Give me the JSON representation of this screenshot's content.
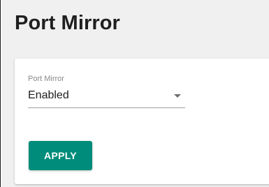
{
  "page": {
    "title": "Port Mirror"
  },
  "form": {
    "port_mirror": {
      "label": "Port Mirror",
      "value": "Enabled"
    },
    "apply_label": "APPLY"
  },
  "colors": {
    "accent": "#008c7a",
    "background": "#f0f0f0",
    "card": "#ffffff"
  },
  "icons": {
    "dropdown": "dropdown-arrow-icon"
  }
}
